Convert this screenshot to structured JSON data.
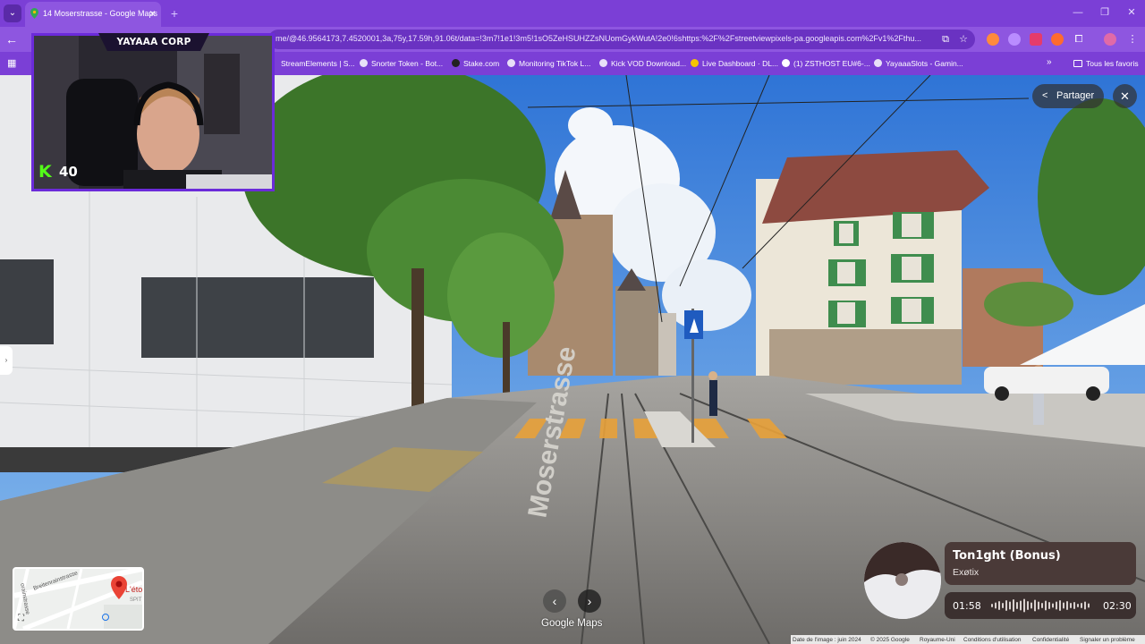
{
  "browser": {
    "tab_title": "14 Moserstrasse - Google Maps",
    "url": "me/@46.9564173,7.4520001,3a,75y,17.59h,91.06t/data=!3m7!1e1!3m5!1sO5ZeHSUHZZsNUomGykWutA!2e0!6shttps:%2F%2Fstreetviewpixels-pa.googleapis.com%2Fv1%2Fthu...",
    "bookmarks": [
      "StreamElements | S...",
      "Snorter Token - Bot...",
      "Stake.com",
      "Monitoring TikTok L...",
      "Kick VOD Download...",
      "Live Dashboard · DL...",
      "(1) ZSTHOST EU#6-...",
      "YayaaaSlots - Gamin..."
    ],
    "all_favorites": "Tous les favoris"
  },
  "webcam": {
    "name": "YAYAAA CORP",
    "kick_count": "40"
  },
  "streetview": {
    "share_label": "Partager",
    "road_marking": "Moserstrasse",
    "google_logo": "Google Maps",
    "minimap": {
      "poi": "L'éto",
      "poi_sub": "SPIT",
      "street_1": "Breitenrainstrasse",
      "street_2": "orainstrasse"
    },
    "footer": [
      "Date de l'image : juin 2024",
      "© 2025 Google",
      "Royaume-Uni",
      "Conditions d'utilisation",
      "Confidentialité",
      "Signaler un problème"
    ]
  },
  "music": {
    "title": "Ton1ght (Bonus)",
    "artist": "Exøtix",
    "current_time": "01:58",
    "total_time": "02:30"
  },
  "colors": {
    "browser_theme": "#7b3fd6",
    "webcam_border": "#6b2bd9",
    "kick_green": "#53fc18",
    "music_card": "#4a3a38"
  }
}
